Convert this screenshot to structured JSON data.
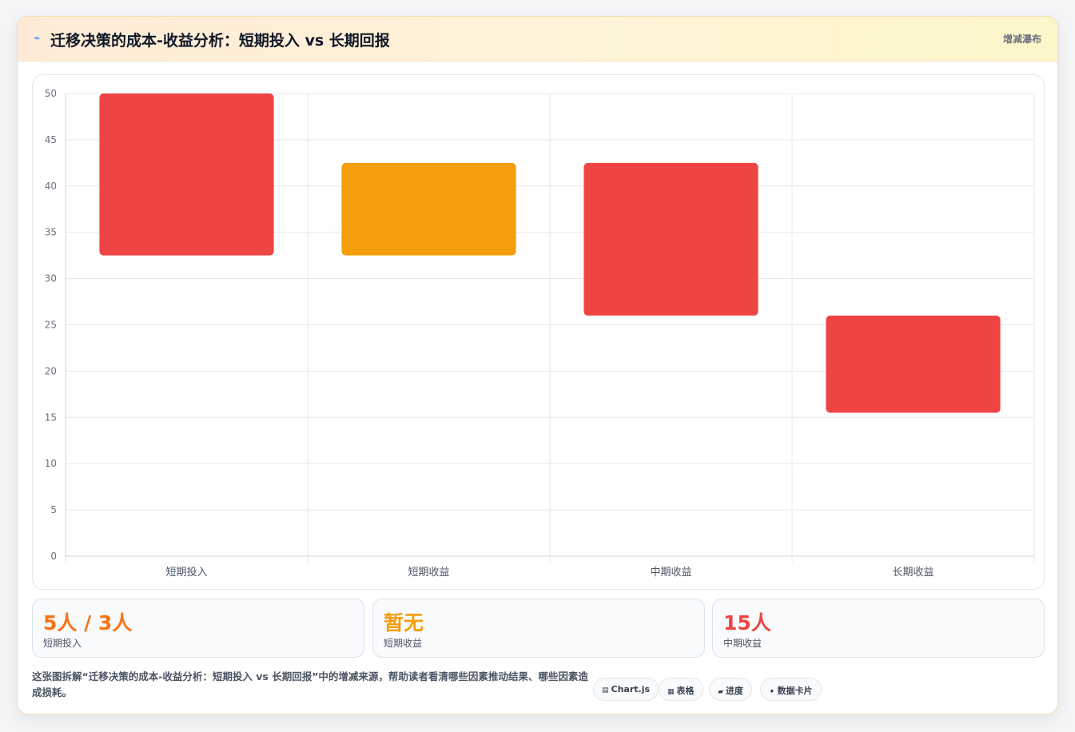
{
  "header": {
    "icon": "lightning-icon",
    "title": "迁移决策的成本-收益分析：短期投入 vs 长期回报",
    "tag": "增减瀑布"
  },
  "chart_data": {
    "type": "bar",
    "subtype": "waterfall",
    "categories": [
      "短期投入",
      "短期收益",
      "中期收益",
      "长期收益"
    ],
    "ranges": [
      [
        32.5,
        50
      ],
      [
        32.5,
        42.5
      ],
      [
        26,
        42.5
      ],
      [
        15.5,
        26
      ]
    ],
    "colors": [
      "#ef4444",
      "#f59e0b",
      "#ef4444",
      "#ef4444"
    ],
    "ylim": [
      0,
      50
    ],
    "yticks": [
      0,
      5,
      10,
      15,
      20,
      25,
      30,
      35,
      40,
      45,
      50
    ],
    "grid": true
  },
  "stats": [
    {
      "value": "5人 / 3人",
      "label": "短期投入",
      "color": "#f97316"
    },
    {
      "value": "暂无",
      "label": "短期收益",
      "color": "#f59e0b"
    },
    {
      "value": "15人",
      "label": "中期收益",
      "color": "#ef4444"
    }
  ],
  "description": "这张图拆解“迁移决策的成本-收益分析：短期投入 vs 长期回报”中的增减来源，帮助读者看清哪些因素推动结果、哪些因素造成损耗。",
  "chips": [
    {
      "icon": "▤",
      "label": "Chart.js"
    },
    {
      "icon": "▦",
      "label": "表格"
    },
    {
      "icon": "▰",
      "label": "进度"
    },
    {
      "icon": "✦",
      "label": "数据卡片"
    }
  ]
}
